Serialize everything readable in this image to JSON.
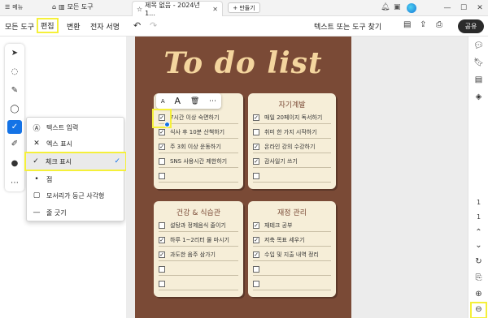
{
  "titlebar": {
    "menu_label": "메뉴",
    "tools_tab_label": "모든 도구",
    "doc_tab_label": "제목 없음 - 2024년 1...",
    "new_tab_label": "+ 만들기"
  },
  "toolbar": {
    "items": [
      {
        "label": "모든 도구"
      },
      {
        "label": "편집"
      },
      {
        "label": "변환"
      },
      {
        "label": "전자 서명"
      }
    ],
    "find_label": "텍스트 또는 도구 찾기",
    "share_label": "공유"
  },
  "dropdown": {
    "items": [
      {
        "label": "텍스트 입력",
        "icon": "text-box-icon"
      },
      {
        "label": "엑스 표시",
        "icon": "cross-mark-icon"
      },
      {
        "label": "체크 표시",
        "icon": "check-mark-icon",
        "selected": true
      },
      {
        "label": "점",
        "icon": "dot-icon"
      },
      {
        "label": "모서리가 둥근 사각형",
        "icon": "rounded-rect-icon"
      },
      {
        "label": "줄 긋기",
        "icon": "strikeline-icon"
      }
    ]
  },
  "page": {
    "title": "To do list",
    "cards": [
      {
        "title": "",
        "rows": [
          {
            "text": "7시간 이상 숙면하기",
            "checked": true
          },
          {
            "text": "식사 후 10분 산책하기",
            "checked": true
          },
          {
            "text": "주 3회 이상 운동하기",
            "checked": true
          },
          {
            "text": "SNS 사용시간 제한하기",
            "checked": false
          },
          {
            "text": "",
            "checked": false
          }
        ]
      },
      {
        "title": "자기계발",
        "rows": [
          {
            "text": "매일 20페이지 독서하기",
            "checked": true
          },
          {
            "text": "취미 한 가지 시작하기",
            "checked": false
          },
          {
            "text": "온라인 강의 수강하기",
            "checked": true
          },
          {
            "text": "감사일기 쓰기",
            "checked": true
          },
          {
            "text": "",
            "checked": false
          }
        ]
      },
      {
        "title": "건강 & 식습관",
        "rows": [
          {
            "text": "설탕과 정제음식 줄이기",
            "checked": false
          },
          {
            "text": "하루 1~2리터 물 마시기",
            "checked": true
          },
          {
            "text": "과도한 음주 삼가기",
            "checked": true
          },
          {
            "text": "",
            "checked": false
          },
          {
            "text": "",
            "checked": false
          }
        ]
      },
      {
        "title": "재정 관리",
        "rows": [
          {
            "text": "재테크 공부",
            "checked": true
          },
          {
            "text": "저축 목표 세우기",
            "checked": true
          },
          {
            "text": "수입 및 지출 내역 정리",
            "checked": true
          },
          {
            "text": "",
            "checked": false
          },
          {
            "text": "",
            "checked": false
          }
        ]
      }
    ]
  },
  "minibar": {
    "small_a": "A",
    "large_a": "A"
  },
  "right_panel": {
    "page_current": "1",
    "page_total": "1"
  },
  "colors": {
    "accent": "#1473e6",
    "highlight": "#f5f03a",
    "page_bg": "#7a4a36",
    "card_bg": "#f6eed8",
    "title_color": "#f4d59e"
  }
}
